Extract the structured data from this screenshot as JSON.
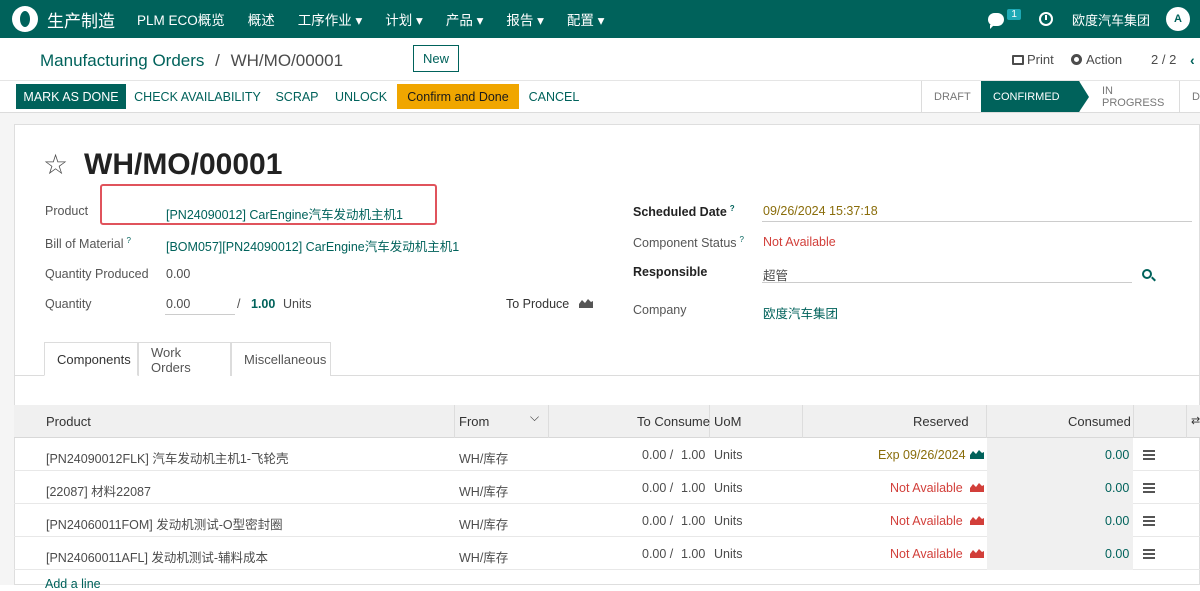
{
  "topbar": {
    "brand": "生产制造",
    "nav": [
      "PLM ECO概览",
      "概述",
      "工序作业 ▾",
      "计划 ▾",
      "产品 ▾",
      "报告 ▾",
      "配置 ▾"
    ],
    "chat_count": "1",
    "company": "欧度汽车集团",
    "avatar": "A"
  },
  "breadcrumb": {
    "parent": "Manufacturing Orders",
    "sep": "/",
    "current": "WH/MO/00001"
  },
  "controls": {
    "new": "New",
    "print": "Print",
    "action": "Action",
    "pager": "2 / 2",
    "prev": "‹"
  },
  "buttons": {
    "mark_as_done": "MARK AS DONE",
    "check_availability": "CHECK AVAILABILITY",
    "scrap": "SCRAP",
    "unlock": "UNLOCK",
    "confirm_and_done": "Confirm and Done",
    "cancel": "CANCEL"
  },
  "statusbar": {
    "draft": "DRAFT",
    "confirmed": "CONFIRMED",
    "in_progress": "IN PROGRESS",
    "done": "DO"
  },
  "form": {
    "title": "WH/MO/00001",
    "product_label": "Product",
    "product_value": "[PN24090012] CarEngine汽车发动机主机1",
    "bom_label": "Bill of Material",
    "bom_help": "?",
    "bom_value": "[BOM057][PN24090012] CarEngine汽车发动机主机1",
    "qty_produced_label": "Quantity Produced",
    "qty_produced_value": "0.00",
    "quantity_label": "Quantity",
    "quantity_value": "0.00",
    "quantity_sep": "/",
    "quantity_total": "1.00",
    "quantity_unit": "Units",
    "to_produce_label": "To Produce",
    "scheduled_label": "Scheduled Date",
    "scheduled_help": "?",
    "scheduled_value": "09/26/2024 15:37:18",
    "component_status_label": "Component Status",
    "component_status_help": "?",
    "component_status_value": "Not Available",
    "responsible_label": "Responsible",
    "responsible_value": "超管",
    "company_label": "Company",
    "company_value": "欧度汽车集团"
  },
  "tabs": [
    "Components",
    "Work Orders",
    "Miscellaneous"
  ],
  "table": {
    "headers": {
      "product": "Product",
      "from": "From",
      "to_consume": "To Consume",
      "uom": "UoM",
      "reserved": "Reserved",
      "consumed": "Consumed"
    },
    "rows": [
      {
        "product": "[PN24090012FLK] 汽车发动机主机1-飞轮壳",
        "from": "WH/库存",
        "consume": "0.00 /",
        "total": "1.00",
        "uom": "Units",
        "reserved": "Exp 09/26/2024",
        "consumed": "0.00"
      },
      {
        "product": "[22087] 材料22087",
        "from": "WH/库存",
        "consume": "0.00 /",
        "total": "1.00",
        "uom": "Units",
        "reserved": "Not Available",
        "consumed": "0.00"
      },
      {
        "product": "[PN24060011FOM] 发动机测试-O型密封圈",
        "from": "WH/库存",
        "consume": "0.00 /",
        "total": "1.00",
        "uom": "Units",
        "reserved": "Not Available",
        "consumed": "0.00"
      },
      {
        "product": "[PN24060011AFL] 发动机测试-辅料成本",
        "from": "WH/库存",
        "consume": "0.00 /",
        "total": "1.00",
        "uom": "Units",
        "reserved": "Not Available",
        "consumed": "0.00"
      }
    ],
    "add_line": "Add a line"
  },
  "colors": {
    "primary": "#00625b",
    "warning": "#f0a600",
    "danger": "#d23f3a",
    "highlight": "#e0535c"
  }
}
